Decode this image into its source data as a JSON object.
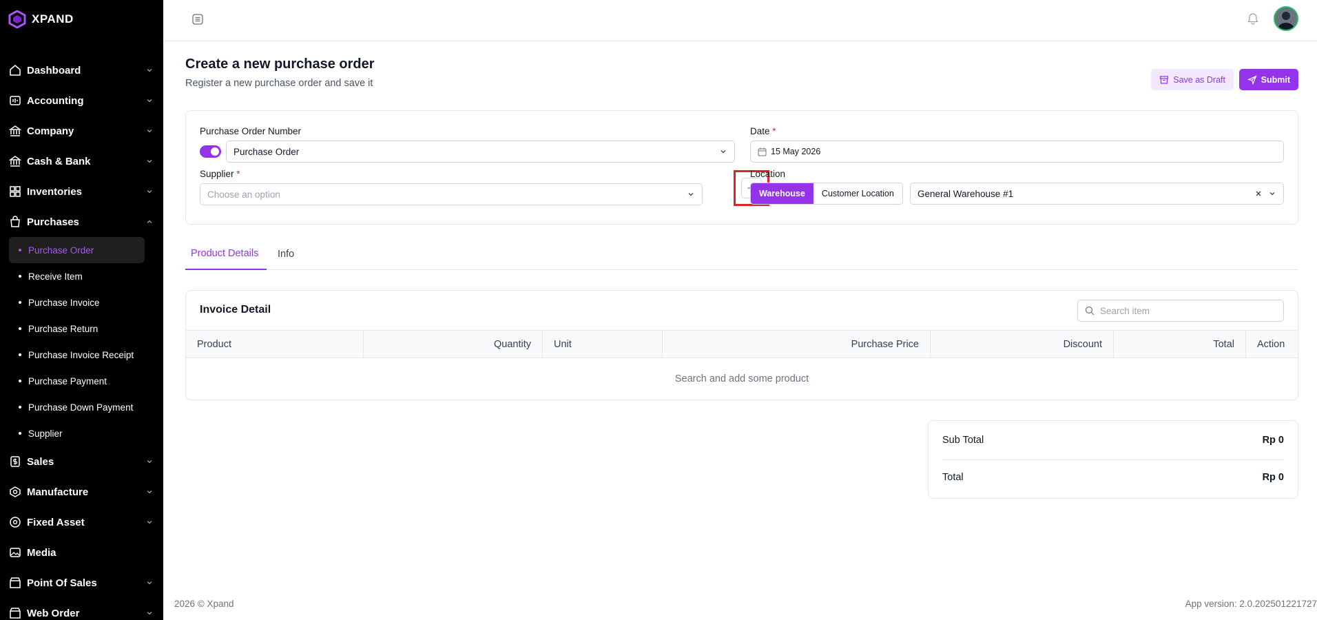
{
  "brand": {
    "name": "XPAND"
  },
  "sidebar": {
    "items": [
      {
        "label": "Dashboard",
        "icon": "home-icon"
      },
      {
        "label": "Accounting",
        "icon": "accounting-icon"
      },
      {
        "label": "Company",
        "icon": "bank-icon"
      },
      {
        "label": "Cash & Bank",
        "icon": "bank-icon"
      },
      {
        "label": "Inventories",
        "icon": "grid-icon"
      },
      {
        "label": "Purchases",
        "icon": "bag-icon",
        "expanded": true
      }
    ],
    "purchases_sub": [
      {
        "label": "Purchase Order",
        "active": true
      },
      {
        "label": "Receive Item"
      },
      {
        "label": "Purchase Invoice"
      },
      {
        "label": "Purchase Return"
      },
      {
        "label": "Purchase Invoice Receipt"
      },
      {
        "label": "Purchase Payment"
      },
      {
        "label": "Purchase Down Payment"
      },
      {
        "label": "Supplier"
      }
    ],
    "items_after": [
      {
        "label": "Sales",
        "icon": "dollar-icon"
      },
      {
        "label": "Manufacture",
        "icon": "factory-icon"
      },
      {
        "label": "Fixed Asset",
        "icon": "asset-icon"
      },
      {
        "label": "Media",
        "icon": "image-icon"
      },
      {
        "label": "Point Of Sales",
        "icon": "store-icon"
      },
      {
        "label": "Web Order",
        "icon": "store-icon"
      }
    ]
  },
  "header": {
    "title": "Create a new purchase order",
    "subtitle": "Register a new purchase order and save it",
    "save_draft_label": "Save as Draft",
    "submit_label": "Submit"
  },
  "form": {
    "po_number_label": "Purchase Order Number",
    "po_number_value": "Purchase Order",
    "date_label": "Date",
    "date_value": "15 May 2026",
    "supplier_label": "Supplier",
    "supplier_placeholder": "Choose an option",
    "location_label": "Location",
    "location_options": [
      "Warehouse",
      "Customer Location"
    ],
    "location_selected": "Warehouse",
    "warehouse_value": "General Warehouse #1",
    "required_mark": "*"
  },
  "tabs": [
    {
      "label": "Product Details",
      "active": true
    },
    {
      "label": "Info",
      "active": false
    }
  ],
  "invoice": {
    "title": "Invoice Detail",
    "search_placeholder": "Search item",
    "columns": [
      "Product",
      "Quantity",
      "Unit",
      "Purchase Price",
      "Discount",
      "Total",
      "Action"
    ],
    "empty_text": "Search and add some product"
  },
  "totals": {
    "subtotal_label": "Sub Total",
    "subtotal_value": "Rp 0",
    "total_label": "Total",
    "total_value": "Rp 0"
  },
  "footer": {
    "copyright": "2026 ©  Xpand",
    "version": "App version:  2.0.202501221727"
  },
  "colors": {
    "accent": "#9333ea",
    "sidebar_bg": "#000000",
    "highlight": "#dc2626"
  }
}
